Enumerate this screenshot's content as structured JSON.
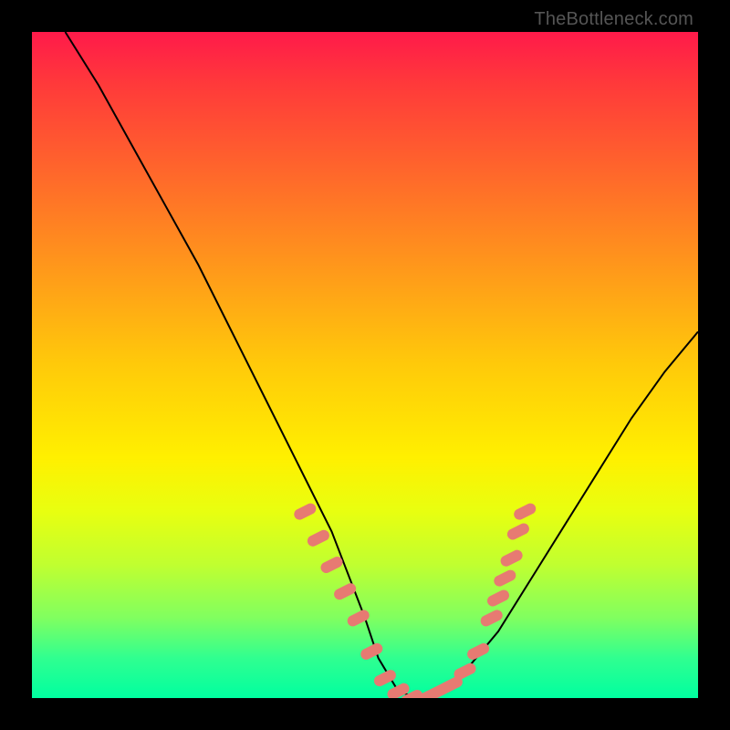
{
  "watermark": "TheBottleneck.com",
  "chart_data": {
    "type": "line",
    "title": "",
    "xlabel": "",
    "ylabel": "",
    "xlim": [
      0,
      100
    ],
    "ylim": [
      0,
      100
    ],
    "grid": false,
    "series": [
      {
        "name": "bottleneck-curve",
        "color": "#000000",
        "x": [
          5,
          10,
          15,
          20,
          25,
          30,
          35,
          40,
          45,
          50,
          52,
          55,
          58,
          60,
          62,
          65,
          70,
          75,
          80,
          85,
          90,
          95,
          100
        ],
        "y": [
          100,
          92,
          83,
          74,
          65,
          55,
          45,
          35,
          25,
          12,
          6,
          1,
          0,
          0,
          1,
          4,
          10,
          18,
          26,
          34,
          42,
          49,
          55
        ]
      }
    ],
    "highlight_points": {
      "name": "highlight-dots",
      "color": "#e77a72",
      "x": [
        41,
        43,
        45,
        47,
        49,
        51,
        53,
        55,
        57,
        59,
        61,
        63,
        65,
        67,
        69,
        70,
        71,
        72,
        73,
        74
      ],
      "y": [
        28,
        24,
        20,
        16,
        12,
        7,
        3,
        1,
        0,
        0,
        1,
        2,
        4,
        7,
        12,
        15,
        18,
        21,
        25,
        28
      ]
    }
  }
}
